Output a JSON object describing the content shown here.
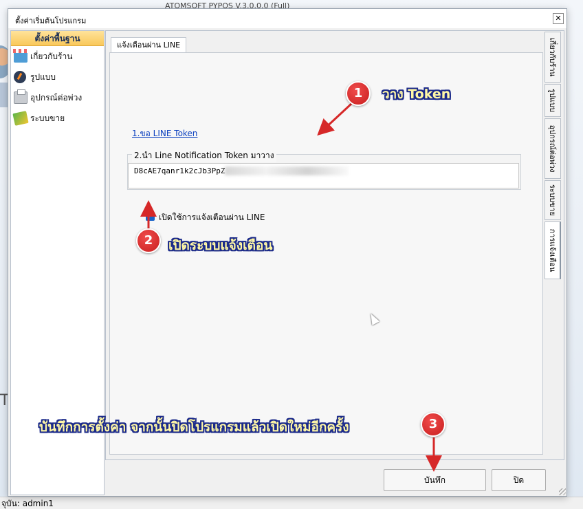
{
  "background": {
    "title": "ATOMSOFT PYPOS V.3.0.0.0 (Full)",
    "left_partial": "ยเ",
    "letter": "T",
    "status": "จุบัน: admin1"
  },
  "dialog": {
    "title": "ตั้งค่าเริ่มต้นโปรแกรม",
    "close_symbol": "✕"
  },
  "leftnav": {
    "header": "ตั้งค่าพื้นฐาน",
    "items": [
      {
        "label": "เกี่ยวกับร้าน",
        "icon": "store-icon"
      },
      {
        "label": "รูปแบบ",
        "icon": "palette-icon"
      },
      {
        "label": "อุปกรณ์ต่อพ่วง",
        "icon": "printer-icon"
      },
      {
        "label": "ระบบขาย",
        "icon": "sale-icon"
      }
    ]
  },
  "tab": {
    "active_label": "แจ้งเตือนผ่าน LINE",
    "get_token_link": "1.ขอ LINE Token",
    "token_group_label": "2.นำ Line Notification Token มาวาง",
    "token_value": "D8cAE7qanr1k2cJb3PpZ",
    "checkbox_label": "เปิดใช้การแจ้งเตือนผ่าน LINE",
    "checkbox_checked": true,
    "check_mark": "✓"
  },
  "side_tabs": [
    "เกี่ยวกับร้าน",
    "รูปแบบ",
    "อุปกรณ์ต่อพ่วง",
    "ระบบขาย",
    "การแจ้งเตือน"
  ],
  "buttons": {
    "save": "บันทึก",
    "close": "ปิด"
  },
  "annotations": {
    "step1_num": "1",
    "step1_text": "วาง Token",
    "step2_num": "2",
    "step2_text": "เปิดระบบแจ้งเตือน",
    "step3_num": "3",
    "step3_text": "บันทึกการตั้งค่า จากนั้นปิดโปรแกรมแล้วเปิดใหม่อีกครั้ง",
    "color_badge": "#d62828",
    "color_text": "#fff7a6",
    "color_outline": "#1b2a8a"
  }
}
